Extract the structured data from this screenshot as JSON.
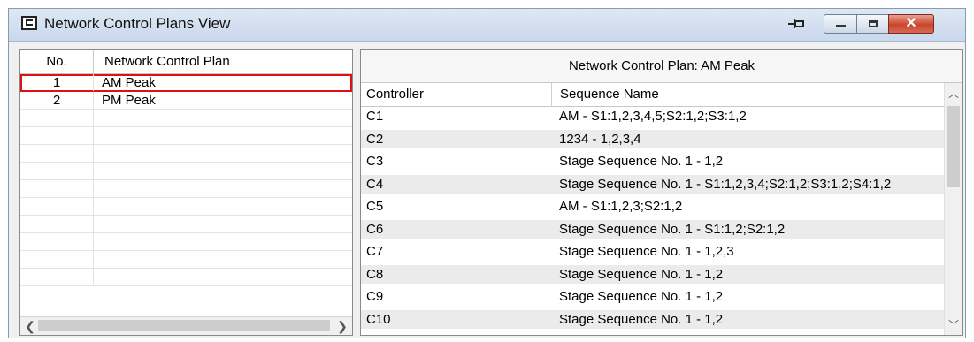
{
  "window": {
    "title": "Network Control Plans View"
  },
  "plans": {
    "headers": {
      "no": "No.",
      "plan": "Network Control Plan"
    },
    "rows": [
      {
        "no": "1",
        "name": "AM Peak"
      },
      {
        "no": "2",
        "name": "PM Peak"
      }
    ]
  },
  "detail": {
    "title": "Network Control Plan: AM Peak",
    "headers": {
      "controller": "Controller",
      "sequence": "Sequence Name"
    },
    "rows": [
      {
        "controller": "C1",
        "sequence": "AM - S1:1,2,3,4,5;S2:1,2;S3:1,2"
      },
      {
        "controller": "C2",
        "sequence": "1234 - 1,2,3,4"
      },
      {
        "controller": "C3",
        "sequence": "Stage Sequence No. 1 - 1,2"
      },
      {
        "controller": "C4",
        "sequence": "Stage Sequence No. 1 - S1:1,2,3,4;S2:1,2;S3:1,2;S4:1,2"
      },
      {
        "controller": "C5",
        "sequence": "AM - S1:1,2,3;S2:1,2"
      },
      {
        "controller": "C6",
        "sequence": "Stage Sequence No. 1 - S1:1,2;S2:1,2"
      },
      {
        "controller": "C7",
        "sequence": "Stage Sequence No. 1 - 1,2,3"
      },
      {
        "controller": "C8",
        "sequence": "Stage Sequence No. 1 - 1,2"
      },
      {
        "controller": "C9",
        "sequence": "Stage Sequence No. 1 - 1,2"
      },
      {
        "controller": "C10",
        "sequence": "Stage Sequence No. 1 - 1,2"
      }
    ]
  },
  "icons": {
    "app": "network-plan-icon",
    "pin": "pin-icon",
    "minimize": "minimize-icon",
    "maximize": "maximize-icon",
    "close": "close-icon"
  },
  "colors": {
    "selection_outline": "#e01010",
    "close_button": "#c9452c"
  }
}
